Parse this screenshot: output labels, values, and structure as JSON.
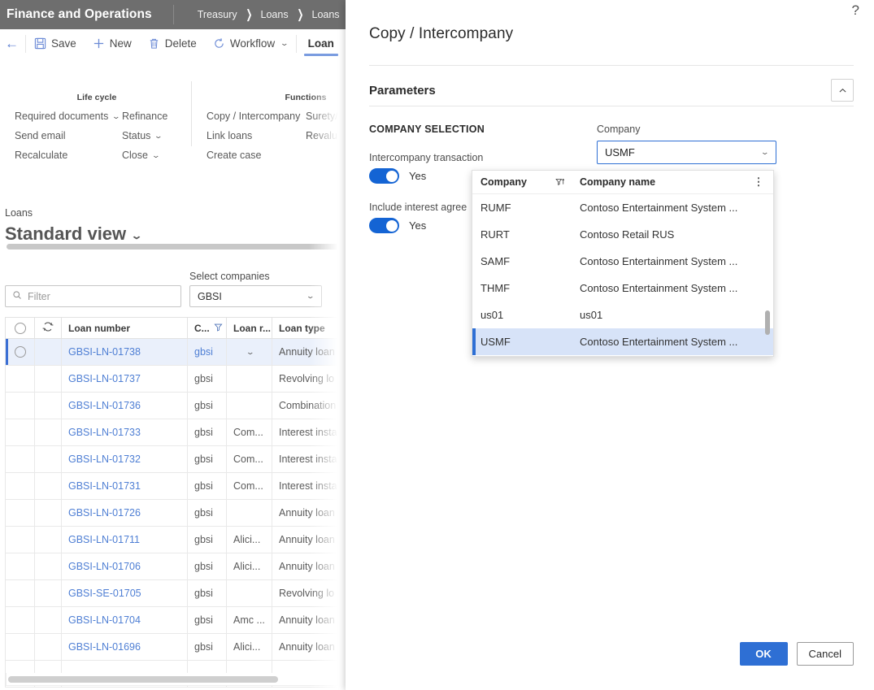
{
  "topbar": {
    "brand": "Finance and Operations",
    "breadcrumb": [
      "Treasury",
      "Loans",
      "Loans"
    ],
    "separator": "❯"
  },
  "toolbar": {
    "back_icon": "←",
    "items": [
      {
        "label": "Save",
        "icon": "save-icon"
      },
      {
        "label": "New",
        "icon": "plus-icon"
      },
      {
        "label": "Delete",
        "icon": "trash-icon"
      },
      {
        "label": "Workflow",
        "icon": "workflow-icon",
        "caret": "⌄"
      }
    ],
    "active_tab": "Loan"
  },
  "action_pane": {
    "groups": [
      {
        "title": "Life cycle",
        "columns": [
          [
            {
              "label": "Required documents",
              "caret": "⌄"
            },
            {
              "label": "Send email",
              "caret": ""
            },
            {
              "label": "Recalculate",
              "caret": ""
            }
          ],
          [
            {
              "label": "Refinance",
              "caret": ""
            },
            {
              "label": "Status",
              "caret": "⌄"
            },
            {
              "label": "Close",
              "caret": "⌄"
            }
          ]
        ]
      },
      {
        "title": "Functions",
        "columns": [
          [
            {
              "label": "Copy / Intercompany",
              "caret": ""
            },
            {
              "label": "Link loans",
              "caret": ""
            },
            {
              "label": "Create case",
              "caret": ""
            }
          ],
          [
            {
              "label": "Surety/",
              "caret": ""
            },
            {
              "label": "Revalua",
              "caret": ""
            }
          ]
        ]
      }
    ]
  },
  "page": {
    "eyebrow": "Loans",
    "title": "Standard view",
    "title_caret": "⌄"
  },
  "filters": {
    "search_placeholder": "Filter",
    "search_icon": "search-icon",
    "select_companies_label": "Select companies",
    "select_companies_value": "GBSI",
    "select_companies_caret": "⌄"
  },
  "grid": {
    "columns": [
      "",
      "",
      "Loan number",
      "C...",
      "Loan r...",
      "Loan type"
    ],
    "column_filter_icon": "filter-icon",
    "refresh_icon": "refresh-icon",
    "rows": [
      {
        "selected": true,
        "loan_number": "GBSI-LN-01738",
        "company": "gbsi",
        "loan_r": "",
        "loan_type": "Annuity loan",
        "caret": "⌄"
      },
      {
        "selected": false,
        "loan_number": "GBSI-LN-01737",
        "company": "gbsi",
        "loan_r": "",
        "loan_type": "Revolving lo",
        "caret": ""
      },
      {
        "selected": false,
        "loan_number": "GBSI-LN-01736",
        "company": "gbsi",
        "loan_r": "",
        "loan_type": "Combination",
        "caret": ""
      },
      {
        "selected": false,
        "loan_number": "GBSI-LN-01733",
        "company": "gbsi",
        "loan_r": "Com...",
        "loan_type": "Interest insta",
        "caret": ""
      },
      {
        "selected": false,
        "loan_number": "GBSI-LN-01732",
        "company": "gbsi",
        "loan_r": "Com...",
        "loan_type": "Interest insta",
        "caret": ""
      },
      {
        "selected": false,
        "loan_number": "GBSI-LN-01731",
        "company": "gbsi",
        "loan_r": "Com...",
        "loan_type": "Interest insta",
        "caret": ""
      },
      {
        "selected": false,
        "loan_number": "GBSI-LN-01726",
        "company": "gbsi",
        "loan_r": "",
        "loan_type": "Annuity loan",
        "caret": ""
      },
      {
        "selected": false,
        "loan_number": "GBSI-LN-01711",
        "company": "gbsi",
        "loan_r": "Alici...",
        "loan_type": "Annuity loan",
        "caret": ""
      },
      {
        "selected": false,
        "loan_number": "GBSI-LN-01706",
        "company": "gbsi",
        "loan_r": "Alici...",
        "loan_type": "Annuity loan",
        "caret": ""
      },
      {
        "selected": false,
        "loan_number": "GBSI-SE-01705",
        "company": "gbsi",
        "loan_r": "",
        "loan_type": "Revolving lo",
        "caret": ""
      },
      {
        "selected": false,
        "loan_number": "GBSI-LN-01704",
        "company": "gbsi",
        "loan_r": "Amc ...",
        "loan_type": "Annuity loan",
        "caret": ""
      },
      {
        "selected": false,
        "loan_number": "GBSI-LN-01696",
        "company": "gbsi",
        "loan_r": "Alici...",
        "loan_type": "Annuity loan",
        "caret": ""
      },
      {
        "selected": false,
        "loan_number": "",
        "company": "",
        "loan_r": "",
        "loan_type": "",
        "caret": ""
      }
    ]
  },
  "dialog": {
    "help_icon": "?",
    "title": "Copy / Intercompany",
    "section_title": "Parameters",
    "collapse_icon": "chevron-up-icon",
    "group_label": "COMPANY SELECTION",
    "fields": [
      {
        "label": "Intercompany transaction",
        "value": "Yes"
      },
      {
        "label": "Include interest agree",
        "value": "Yes"
      }
    ],
    "company": {
      "label": "Company",
      "value": "USMF",
      "caret": "⌄"
    },
    "dropdown": {
      "headers": {
        "code": "Company",
        "name": "Company name"
      },
      "filter_icon": "filter-sort-icon",
      "overflow_icon": "more-vertical-icon",
      "rows": [
        {
          "code": "RUMF",
          "name": "Contoso Entertainment System ...",
          "selected": false
        },
        {
          "code": "RURT",
          "name": "Contoso Retail RUS",
          "selected": false
        },
        {
          "code": "SAMF",
          "name": "Contoso Entertainment System ...",
          "selected": false
        },
        {
          "code": "THMF",
          "name": "Contoso Entertainment System ...",
          "selected": false
        },
        {
          "code": "us01",
          "name": "us01",
          "selected": false
        },
        {
          "code": "USMF",
          "name": "Contoso Entertainment System ...",
          "selected": true
        }
      ]
    },
    "footer": {
      "ok": "OK",
      "cancel": "Cancel"
    }
  },
  "colors": {
    "accent": "#2e6fd4",
    "header_bg": "#6e6e6e",
    "link": "#4f7fd4",
    "selected_row": "#eaf0fb",
    "dropdown_selected": "#d7e3f8"
  }
}
